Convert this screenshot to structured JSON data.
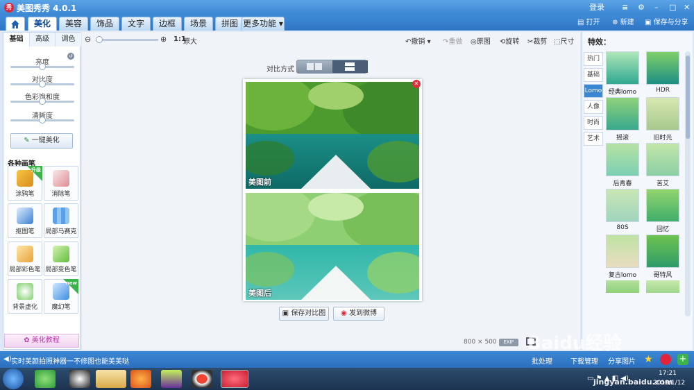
{
  "title_bar": {
    "app_title": "美图秀秀 4.0.1",
    "logo_text": "秀",
    "login": "登录",
    "min": "–",
    "max": "□",
    "close": "✕",
    "menu": "≡"
  },
  "nav": {
    "tabs": [
      "美化",
      "美容",
      "饰品",
      "文字",
      "边框",
      "场景",
      "拼图",
      "更多功能 ▾"
    ],
    "open": "打开",
    "new": "新建",
    "save_share": "保存与分享"
  },
  "left_panel": {
    "subtabs": [
      "基础",
      "高级",
      "调色"
    ],
    "sliders": {
      "brightness": "亮度",
      "contrast": "对比度",
      "saturation": "色彩饱和度",
      "sharpness": "清晰度"
    },
    "slider_values": {
      "brightness": 0.5,
      "contrast": 0.5,
      "saturation": 0.5,
      "sharpness": 0.5
    },
    "one_click": "一键美化",
    "brush_title": "各种画笔",
    "tools": [
      "涂鸦笔",
      "消除笔",
      "抠图笔",
      "局部马赛克",
      "局部彩色笔",
      "局部变色笔",
      "背景虚化",
      "魔幻笔"
    ],
    "upgrade_badge": "升级",
    "new_badge": "new",
    "tutorial": "美化教程"
  },
  "toolbar": {
    "zoom_ratio": "1:1",
    "original_size": "原大",
    "undo": "撤销",
    "redo": "重做",
    "original": "原图",
    "rotate": "旋转",
    "crop": "裁剪",
    "resize": "尺寸"
  },
  "compare": {
    "label": "对比方式",
    "before": "美图前",
    "after": "美图后",
    "save_compare": "保存对比图",
    "send_weibo": "发到微博",
    "size_text": "800 × 500",
    "exif": "EXIF"
  },
  "right_panel": {
    "title": "特效：",
    "categories": [
      "热门",
      "基础",
      "Lomo",
      "人像",
      "时尚",
      "艺术"
    ],
    "active_category": "Lomo",
    "effects": [
      "经典lomo",
      "HDR",
      "摇滚",
      "旧时光",
      "后青春",
      "苦艾",
      "80S",
      "回忆",
      "复古lomo",
      "哥特风"
    ]
  },
  "status": {
    "text": "实时美颜拍照神器一不修图也能美美哒",
    "batch": "批处理",
    "download": "下载管理",
    "share": "分享图片"
  },
  "taskbar": {
    "time": "17:21",
    "date": "2019/1/12"
  },
  "watermark": {
    "site": "jingyan.baidu.com",
    "brand": "Baidu经验"
  },
  "colors": {
    "accent": "#3b86d2",
    "title_bar": "#4a96dc",
    "status_bar": "#2e75c4",
    "photo_water": "#27a89a"
  }
}
